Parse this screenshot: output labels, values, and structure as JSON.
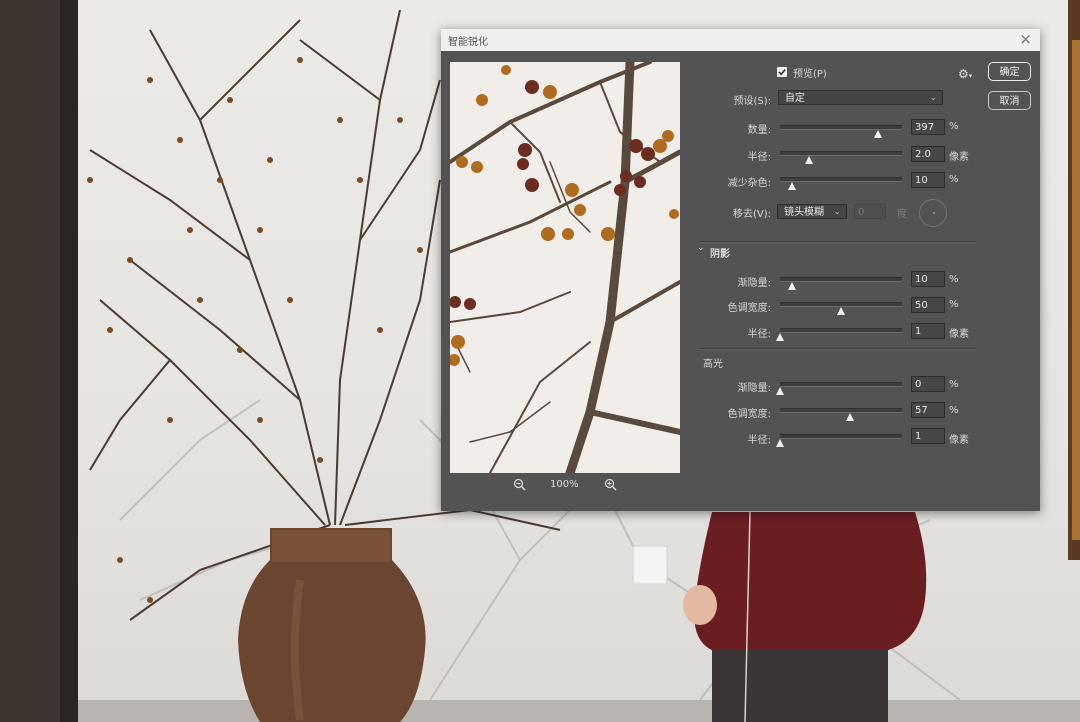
{
  "dialog": {
    "title": "智能锐化",
    "close_icon": "close-icon",
    "preview_checkbox": {
      "checked": true,
      "label": "预览(P)"
    },
    "ok_label": "确定",
    "cancel_label": "取消",
    "preset": {
      "label": "预设(S):",
      "value": "自定"
    },
    "amount": {
      "label": "数量:",
      "value": "397",
      "unit": "%",
      "fraction": 0.8
    },
    "radius": {
      "label": "半径:",
      "value": "2.0",
      "unit": "像素",
      "fraction": 0.24
    },
    "reduce_noise": {
      "label": "减少杂色:",
      "value": "10",
      "unit": "%",
      "fraction": 0.1
    },
    "remove": {
      "label": "移去(V):",
      "value": "镜头模糊",
      "angle_value": "0",
      "angle_unit": "度"
    },
    "shadows": {
      "heading": "阴影",
      "fade": {
        "label": "渐隐量:",
        "value": "10",
        "unit": "%",
        "fraction": 0.1
      },
      "tonal_width": {
        "label": "色调宽度:",
        "value": "50",
        "unit": "%",
        "fraction": 0.5
      },
      "radius": {
        "label": "半径:",
        "value": "1",
        "unit": "像素",
        "fraction": 0.0
      }
    },
    "highlights": {
      "heading": "高光",
      "fade": {
        "label": "渐隐量:",
        "value": "0",
        "unit": "%",
        "fraction": 0.0
      },
      "tonal_width": {
        "label": "色调宽度:",
        "value": "57",
        "unit": "%",
        "fraction": 0.57
      },
      "radius": {
        "label": "半径:",
        "value": "1",
        "unit": "像素",
        "fraction": 0.0
      }
    },
    "zoom": {
      "value": "100%"
    }
  }
}
